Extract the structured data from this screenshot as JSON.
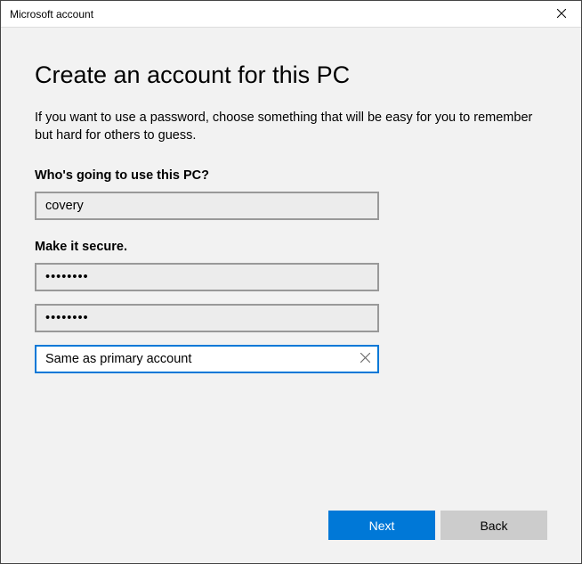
{
  "window": {
    "title": "Microsoft account"
  },
  "page": {
    "heading": "Create an account for this PC",
    "description": "If you want to use a password, choose something that will be easy for you to remember but hard for others to guess.",
    "username_label": "Who's going to use this PC?",
    "username_value": "covery",
    "secure_label": "Make it secure.",
    "password_value": "••••••••",
    "confirm_value": "••••••••",
    "hint_value": "Same as primary account"
  },
  "footer": {
    "next_label": "Next",
    "back_label": "Back"
  }
}
